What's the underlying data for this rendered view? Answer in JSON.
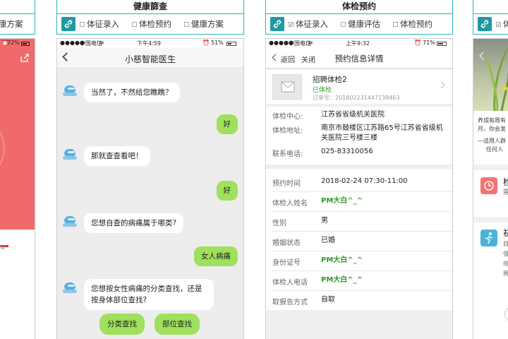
{
  "panel1": {
    "step_partial": "康方案",
    "status": {
      "battery": "72%"
    }
  },
  "panel2": {
    "title": "健康篩查",
    "steps": [
      "体征录入",
      "体检预约",
      "健康方案"
    ],
    "status": {
      "carrier": "中国电信",
      "time": "下午4:59",
      "battery": "51%"
    },
    "nav_title": "小慈智能医生",
    "messages": [
      {
        "from": "bot",
        "text": "当然了，不然给您瞧瞧？"
      },
      {
        "from": "me",
        "text": "好"
      },
      {
        "from": "bot",
        "text": "那就查查看吧！"
      },
      {
        "from": "me",
        "text": "好"
      },
      {
        "from": "bot",
        "text": "您想自查的病痛属于哪类?"
      },
      {
        "from": "me",
        "text": "女人病痛"
      },
      {
        "from": "bot",
        "text": "您想按女性病痛的分类查找，还是按身体部位查找?"
      }
    ],
    "choices": [
      "分类查找",
      "部位查找"
    ]
  },
  "panel3": {
    "title": "体检预约",
    "steps": [
      {
        "label": "体征录入",
        "checked": true
      },
      {
        "label": "健康评估",
        "checked": false
      },
      {
        "label": "体检预约",
        "checked": false
      }
    ],
    "status": {
      "carrier": "中国电信",
      "time": "上午9:32",
      "battery": "71%"
    },
    "nav": {
      "back": "返回",
      "close": "关闭",
      "title": "预约信息详情"
    },
    "order": {
      "name": "招聘体检2",
      "state": "已体检",
      "number": "订单号：201802231447138463"
    },
    "center": {
      "label": "体检中心:",
      "value": "江苏省省级机关医院"
    },
    "address": {
      "label": "体检地址:",
      "value": "南京市鼓楼区江苏路65号江苏省省级机关医院三号楼三楼"
    },
    "phone": {
      "label": "联系电话:",
      "value": "025-83310056"
    },
    "rows": [
      {
        "label": "预约时间",
        "value": "2018-02-24 07:30-11:00",
        "green": false
      },
      {
        "label": "体检人姓名",
        "value": "PM大白^_^",
        "green": true
      },
      {
        "label": "性别",
        "value": "男",
        "green": false
      },
      {
        "label": "婚姻状态",
        "value": "已婚",
        "green": false
      },
      {
        "label": "身份证号",
        "value": "PM大白^_^",
        "green": true
      },
      {
        "label": "体检人电话",
        "value": "PM大白^_^",
        "green": true
      },
      {
        "label": "取报告方式",
        "value": "自取",
        "green": false
      }
    ]
  },
  "panel4": {
    "step_partial": "体",
    "intro_line1": "养成每周有",
    "intro_line2": "月，你会发",
    "intro_line3": "—适用人群",
    "intro_line4": "任何人",
    "item1_char": "检",
    "item1_sub": "完",
    "item2_char": "初",
    "item2_lines": [
      "目",
      "强",
      "排",
      "两"
    ]
  }
}
